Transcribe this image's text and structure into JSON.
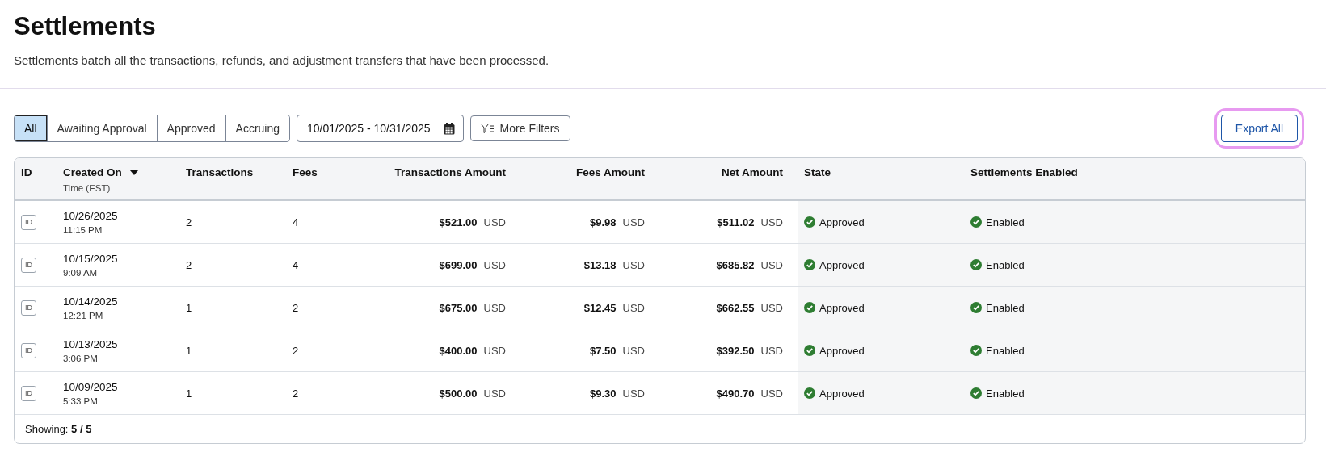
{
  "page": {
    "title": "Settlements",
    "description": "Settlements batch all the transactions, refunds, and adjustment transfers that have been processed."
  },
  "filters": [
    {
      "label": "All",
      "selected": true
    },
    {
      "label": "Awaiting Approval",
      "selected": false
    },
    {
      "label": "Approved",
      "selected": false
    },
    {
      "label": "Accruing",
      "selected": false
    }
  ],
  "date_range": {
    "value": "10/01/2025 - 10/31/2025"
  },
  "more_filters": {
    "label": "More Filters"
  },
  "export": {
    "label": "Export All",
    "highlighted": true
  },
  "table": {
    "columns": [
      {
        "label": "ID",
        "kind": "text"
      },
      {
        "label": "Created On",
        "sub": "Time (EST)",
        "kind": "text",
        "sorted": true
      },
      {
        "label": "Transactions",
        "kind": "text"
      },
      {
        "label": "Fees",
        "kind": "text"
      },
      {
        "label": "Transactions Amount",
        "kind": "amount"
      },
      {
        "label": "Fees Amount",
        "kind": "amount"
      },
      {
        "label": "Net Amount",
        "kind": "amount"
      },
      {
        "label": "State",
        "kind": "text"
      },
      {
        "label": "Settlements Enabled",
        "kind": "text"
      }
    ],
    "rows": [
      {
        "id_badge": "ID",
        "date": "10/26/2025",
        "time": "11:15 PM",
        "transactions": "2",
        "fees": "4",
        "transactions_amount": "$521.00",
        "transactions_currency": "USD",
        "fees_amount": "$9.98",
        "fees_currency": "USD",
        "net_amount": "$511.02",
        "net_currency": "USD",
        "state": "Approved",
        "enabled": "Enabled"
      },
      {
        "id_badge": "ID",
        "date": "10/15/2025",
        "time": "9:09 AM",
        "transactions": "2",
        "fees": "4",
        "transactions_amount": "$699.00",
        "transactions_currency": "USD",
        "fees_amount": "$13.18",
        "fees_currency": "USD",
        "net_amount": "$685.82",
        "net_currency": "USD",
        "state": "Approved",
        "enabled": "Enabled"
      },
      {
        "id_badge": "ID",
        "date": "10/14/2025",
        "time": "12:21 PM",
        "transactions": "1",
        "fees": "2",
        "transactions_amount": "$675.00",
        "transactions_currency": "USD",
        "fees_amount": "$12.45",
        "fees_currency": "USD",
        "net_amount": "$662.55",
        "net_currency": "USD",
        "state": "Approved",
        "enabled": "Enabled"
      },
      {
        "id_badge": "ID",
        "date": "10/13/2025",
        "time": "3:06 PM",
        "transactions": "1",
        "fees": "2",
        "transactions_amount": "$400.00",
        "transactions_currency": "USD",
        "fees_amount": "$7.50",
        "fees_currency": "USD",
        "net_amount": "$392.50",
        "net_currency": "USD",
        "state": "Approved",
        "enabled": "Enabled"
      },
      {
        "id_badge": "ID",
        "date": "10/09/2025",
        "time": "5:33 PM",
        "transactions": "1",
        "fees": "2",
        "transactions_amount": "$500.00",
        "transactions_currency": "USD",
        "fees_amount": "$9.30",
        "fees_currency": "USD",
        "net_amount": "$490.70",
        "net_currency": "USD",
        "state": "Approved",
        "enabled": "Enabled"
      }
    ],
    "footer": "Showing: **5 / 5**"
  }
}
